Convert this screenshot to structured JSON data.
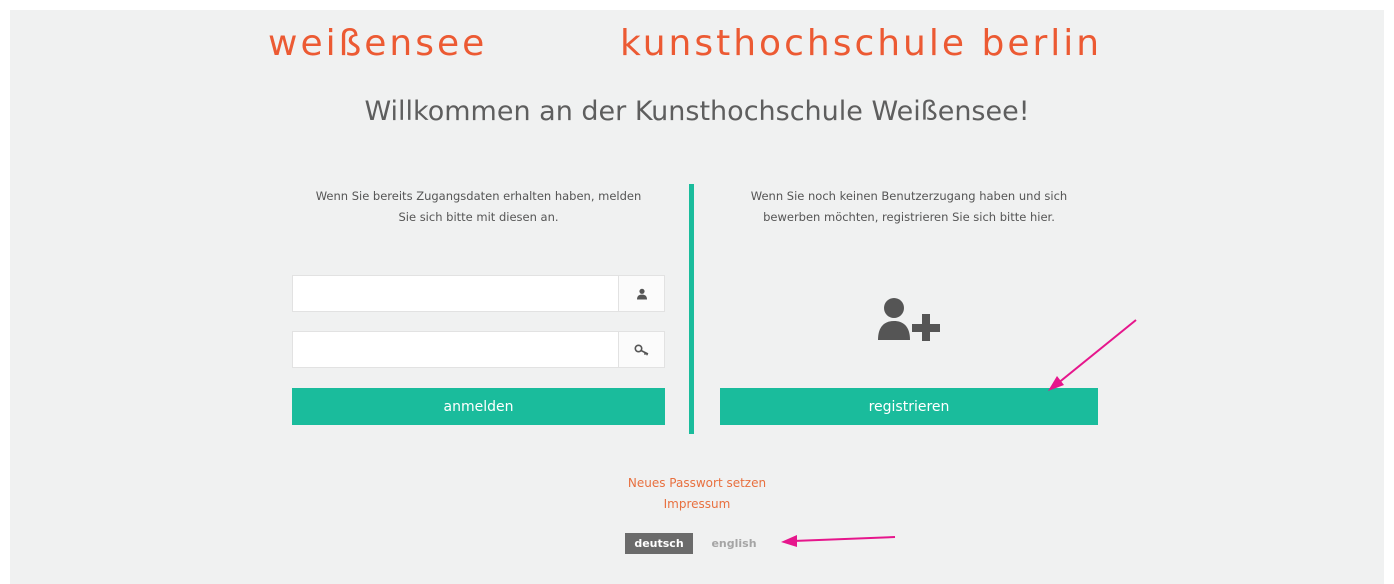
{
  "header": {
    "logo_left": "weißensee",
    "logo_right": "kunsthochschule berlin",
    "welcome": "Willkommen an der Kunsthochschule Weißensee!"
  },
  "login": {
    "intro_line1": "Wenn Sie bereits Zugangsdaten erhalten haben, melden",
    "intro_line2": "Sie sich bitte mit diesen an.",
    "username_value": "",
    "password_value": "",
    "user_icon": "user-icon",
    "key_icon": "key-icon",
    "button_label": "anmelden"
  },
  "register": {
    "intro_line1": "Wenn Sie noch keinen Benutzerzugang haben und sich",
    "intro_line2": "bewerben möchten, registrieren Sie sich bitte hier.",
    "icon": "add-user-icon",
    "button_label": "registrieren"
  },
  "links": {
    "new_password": "Neues Passwort setzen",
    "imprint": "Impressum"
  },
  "language": {
    "active": "deutsch",
    "inactive": "english"
  },
  "colors": {
    "brand": "#ec5a33",
    "accent": "#1abc9c",
    "annotation_arrow": "#e6168c"
  }
}
